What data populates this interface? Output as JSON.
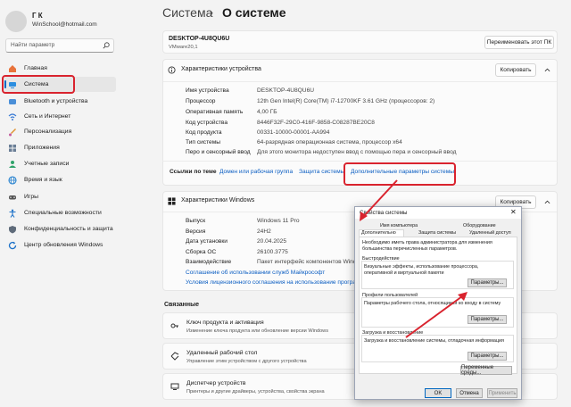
{
  "user": {
    "name": "Г К",
    "email": "WinSchool@hotmail.com"
  },
  "search": {
    "placeholder": "Найти параметр"
  },
  "sidebar": {
    "items": [
      {
        "label": "Главная",
        "icon": "home-icon"
      },
      {
        "label": "Система",
        "icon": "system-icon"
      },
      {
        "label": "Bluetooth и устройства",
        "icon": "bluetooth-icon"
      },
      {
        "label": "Сеть и Интернет",
        "icon": "network-icon"
      },
      {
        "label": "Персонализация",
        "icon": "brush-icon"
      },
      {
        "label": "Приложения",
        "icon": "apps-icon"
      },
      {
        "label": "Учетные записи",
        "icon": "person-icon"
      },
      {
        "label": "Время и язык",
        "icon": "globe-icon"
      },
      {
        "label": "Игры",
        "icon": "gamepad-icon"
      },
      {
        "label": "Специальные возможности",
        "icon": "accessibility-icon"
      },
      {
        "label": "Конфиденциальность и защита",
        "icon": "shield-icon"
      },
      {
        "label": "Центр обновления Windows",
        "icon": "update-icon"
      }
    ]
  },
  "header": {
    "crumb": "Система",
    "separator": "›",
    "title": "О системе"
  },
  "device_card": {
    "name": "DESKTOP-4U8QU6U",
    "model": "VMware20,1",
    "rename_button": "Переименовать этот ПК"
  },
  "specs": {
    "title": "Характеристики устройства",
    "copy_button": "Копировать",
    "rows": [
      {
        "label": "Имя устройства",
        "value": "DESKTOP-4U8QU6U"
      },
      {
        "label": "Процессор",
        "value": "12th Gen Intel(R) Core(TM) i7-12700KF   3.61 GHz (процессоров: 2)"
      },
      {
        "label": "Оперативная память",
        "value": "4,00 ГБ"
      },
      {
        "label": "Код устройства",
        "value": "8446F32F-29C0-416F-9858-C08287BE20C8"
      },
      {
        "label": "Код продукта",
        "value": "00331-10000-00001-AA994"
      },
      {
        "label": "Тип системы",
        "value": "64-разрядная операционная система, процессор x64"
      },
      {
        "label": "Перо и сенсорный ввод",
        "value": "Для этого монитора недоступен ввод с помощью пера и сенсорный ввод"
      }
    ]
  },
  "related_links": {
    "label": "Ссылки по теме",
    "items": [
      "Домен или рабочая группа",
      "Защита системы",
      "Дополнительные параметры системы"
    ]
  },
  "windows_specs": {
    "title": "Характеристики Windows",
    "copy_button": "Копировать",
    "rows": [
      {
        "label": "Выпуск",
        "value": "Windows 11 Pro"
      },
      {
        "label": "Версия",
        "value": "24H2"
      },
      {
        "label": "Дата установки",
        "value": "20.04.2025"
      },
      {
        "label": "Сборка ОС",
        "value": "26100.3775"
      },
      {
        "label": "Взаимодействие",
        "value": "Пакет интерфейс компонентов Windo"
      }
    ],
    "links": [
      "Соглашение об использовании служб Майкрософт",
      "Условия лицензионного соглашения на использование программ"
    ]
  },
  "related": {
    "title": "Связанные",
    "items": [
      {
        "title": "Ключ продукта и активация",
        "subtitle": "Изменение ключа продукта или обновление версии Windows",
        "icon": "key-icon"
      },
      {
        "title": "Удаленный рабочий стол",
        "subtitle": "Управление этим устройством с другого устройства",
        "icon": "remote-desktop-icon"
      },
      {
        "title": "Диспетчер устройств",
        "subtitle": "Принтеры и другие драйверы, устройства, свойства экрана",
        "icon": "device-manager-icon"
      }
    ]
  },
  "dialog": {
    "title": "Свойства системы",
    "tabs_top": [
      "Имя компьютера",
      "Оборудование"
    ],
    "tabs_bottom": [
      "Дополнительно",
      "Защита системы",
      "Удаленный доступ"
    ],
    "note": "Необходимо иметь права администратора для изменения большинства перечисленных параметров.",
    "groups": [
      {
        "title": "Быстродействие",
        "text": "Визуальные эффекты, использование процессора, оперативной и виртуальной памяти",
        "button": "Параметры..."
      },
      {
        "title": "Профили пользователей",
        "text": "Параметры рабочего стола, относящиеся ко входу в систему",
        "button": "Параметры..."
      },
      {
        "title": "Загрузка и восстановление",
        "text": "Загрузка и восстановление системы, отладочная информация",
        "button": "Параметры..."
      }
    ],
    "env_button": "Переменные среды...",
    "ok": "OK",
    "cancel": "Отмена",
    "apply": "Применить"
  },
  "colors": {
    "accent": "#0067c0",
    "highlight": "#d9232e"
  }
}
